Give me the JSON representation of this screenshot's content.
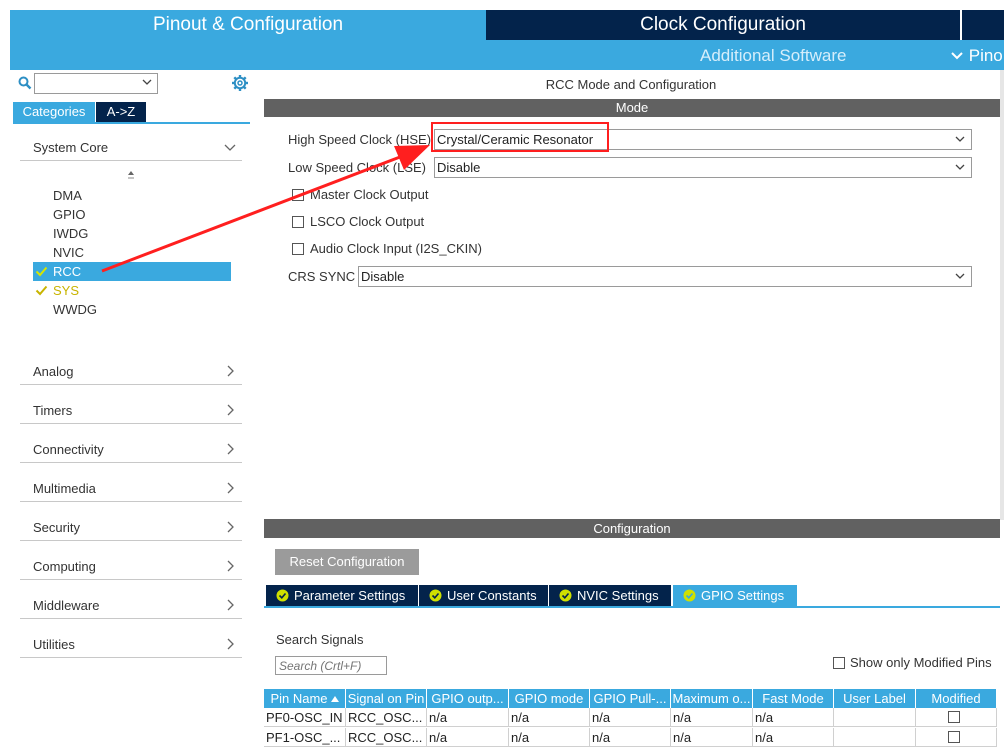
{
  "top_tabs": {
    "pinout": "Pinout & Configuration",
    "clock": "Clock Configuration",
    "additional": "Additional Software",
    "pinout_view": "Pino"
  },
  "left": {
    "search_value": "",
    "tabs": {
      "categories": "Categories",
      "az": "A->Z"
    },
    "categories": {
      "system_core": "System Core",
      "analog": "Analog",
      "timers": "Timers",
      "connectivity": "Connectivity",
      "multimedia": "Multimedia",
      "security": "Security",
      "computing": "Computing",
      "middleware": "Middleware",
      "utilities": "Utilities"
    },
    "core_items": [
      "DMA",
      "GPIO",
      "IWDG",
      "NVIC",
      "RCC",
      "SYS",
      "WWDG"
    ]
  },
  "center": {
    "title": "RCC Mode and Configuration",
    "mode_header": "Mode",
    "hse_label": "High Speed Clock (HSE)",
    "hse_value": "Crystal/Ceramic Resonator",
    "lse_label": "Low Speed Clock (LSE)",
    "lse_value": "Disable",
    "master_clock_output": "Master Clock Output",
    "lsco_clock_output": "LSCO Clock Output",
    "audio_clock_input": "Audio Clock Input (I2S_CKIN)",
    "crs_sync_label": "CRS SYNC",
    "crs_sync_value": "Disable"
  },
  "config": {
    "header": "Configuration",
    "reset_button": "Reset Configuration",
    "tabs": {
      "parameter": "Parameter Settings",
      "user_constants": "User Constants",
      "nvic": "NVIC Settings",
      "gpio": "GPIO Settings"
    },
    "search_signals_label": "Search Signals",
    "search_placeholder": "Search (Crtl+F)",
    "show_modified": "Show only Modified Pins",
    "table": {
      "headers": [
        "Pin Name",
        "Signal on Pin",
        "GPIO outp...",
        "GPIO mode",
        "GPIO Pull-...",
        "Maximum o...",
        "Fast Mode",
        "User Label",
        "Modified"
      ],
      "rows": [
        [
          "PF0-OSC_IN",
          "RCC_OSC...",
          "n/a",
          "n/a",
          "n/a",
          "n/a",
          "n/a",
          "",
          ""
        ],
        [
          "PF1-OSC_...",
          "RCC_OSC...",
          "n/a",
          "n/a",
          "n/a",
          "n/a",
          "n/a",
          "",
          ""
        ]
      ]
    }
  },
  "colors": {
    "accent": "#3aa9df",
    "dark_tab": "#03234b",
    "section_bar": "#616161",
    "annotation_red": "#ff1f1f",
    "check_yellow": "#c8b400"
  }
}
